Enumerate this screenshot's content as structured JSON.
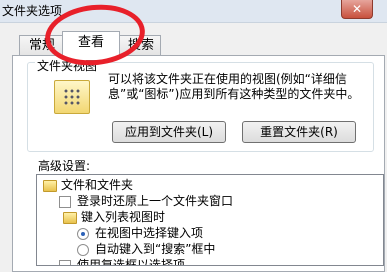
{
  "window": {
    "title": "文件夹选项"
  },
  "tabs": [
    {
      "label": "常规"
    },
    {
      "label": "查看"
    },
    {
      "label": "搜索"
    }
  ],
  "folder_views": {
    "legend": "文件夹视图",
    "description": "可以将该文件夹正在使用的视图(例如“详细信息”或“图标”)应用到所有这种类型的文件夹中。",
    "apply_button": "应用到文件夹(L)",
    "reset_button": "重置文件夹(R)"
  },
  "advanced": {
    "label": "高级设置:",
    "items": [
      {
        "text": "文件和文件夹",
        "kind": "folder",
        "indent": 0
      },
      {
        "text": "登录时还原上一个文件夹窗口",
        "kind": "checkbox",
        "indent": 1
      },
      {
        "text": "键入列表视图时",
        "kind": "folder",
        "indent": 1
      },
      {
        "text": "在视图中选择键入项",
        "kind": "radio",
        "checked": true,
        "indent": 2
      },
      {
        "text": "自动键入到“搜索”框中",
        "kind": "radio",
        "checked": false,
        "indent": 2
      },
      {
        "text": "使用复选框以选择项",
        "kind": "checkbox",
        "indent": 1
      }
    ]
  },
  "annotation": {
    "color": "#e8202a"
  }
}
